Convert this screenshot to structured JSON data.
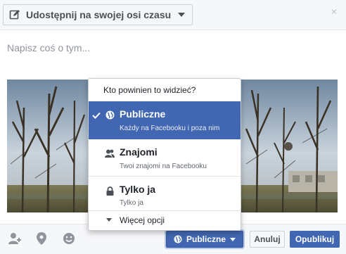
{
  "header": {
    "share_target": "Udostępnij na swojej osi czasu",
    "close_symbol": "×"
  },
  "composer": {
    "placeholder": "Napisz coś o tym..."
  },
  "audience_menu": {
    "heading": "Kto powinien to widzieć?",
    "options": [
      {
        "title": "Publiczne",
        "subtitle": "Każdy na Facebooku i poza nim",
        "icon": "globe-icon",
        "selected": true
      },
      {
        "title": "Znajomi",
        "subtitle": "Twoi znajomi na Facebooku",
        "icon": "friends-icon",
        "selected": false
      },
      {
        "title": "Tylko ja",
        "subtitle": "Tylko ja",
        "icon": "lock-icon",
        "selected": false
      }
    ],
    "more_options": "Więcej opcji"
  },
  "footer": {
    "icons": [
      "tag-friends-icon",
      "location-pin-icon",
      "smiley-icon"
    ],
    "audience_label": "Publiczne",
    "cancel_label": "Anuluj",
    "publish_label": "Opublikuj"
  },
  "colors": {
    "accent": "#4267b2",
    "header_bg": "#f6f7f9",
    "text_muted": "#90949c"
  }
}
